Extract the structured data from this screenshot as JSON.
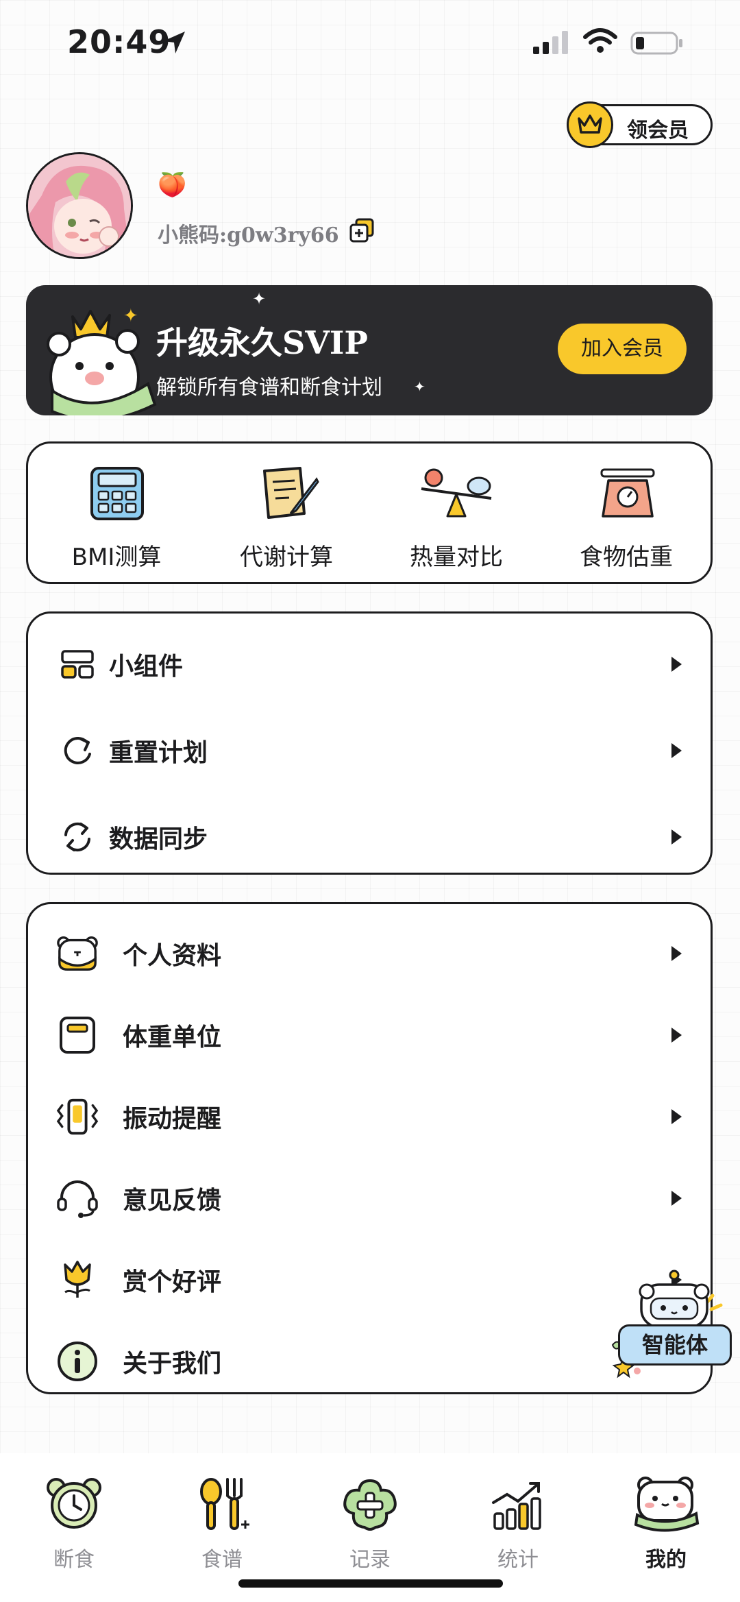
{
  "status_bar": {
    "time": "20:49"
  },
  "vip_button": {
    "label": "领会员"
  },
  "profile": {
    "emoji": "🍑",
    "code_label": "小熊码:g0w3ry66"
  },
  "svip_banner": {
    "title": "升级永久SVIP",
    "subtitle": "解锁所有食谱和断食计划",
    "button_label": "加入会员",
    "colors": {
      "background": "#2b2b2e",
      "button": "#f9c82b"
    }
  },
  "tools": [
    {
      "label": "BMI测算",
      "icon": "calculator-icon"
    },
    {
      "label": "代谢计算",
      "icon": "document-pen-icon"
    },
    {
      "label": "热量对比",
      "icon": "balance-scale-icon"
    },
    {
      "label": "食物估重",
      "icon": "kitchen-scale-icon"
    }
  ],
  "menu_group_1": [
    {
      "label": "小组件",
      "icon": "widget-icon"
    },
    {
      "label": "重置计划",
      "icon": "refresh-icon"
    },
    {
      "label": "数据同步",
      "icon": "sync-icon"
    }
  ],
  "menu_group_2": [
    {
      "label": "个人资料",
      "icon": "bear-profile-icon"
    },
    {
      "label": "体重单位",
      "icon": "scale-icon"
    },
    {
      "label": "振动提醒",
      "icon": "vibration-icon"
    },
    {
      "label": "意见反馈",
      "icon": "headset-icon"
    },
    {
      "label": "赏个好评",
      "icon": "tulip-icon"
    },
    {
      "label": "关于我们",
      "icon": "info-icon"
    }
  ],
  "ai_agent": {
    "label": "智能体"
  },
  "tab_bar": [
    {
      "label": "断食",
      "icon": "alarm-clock-icon",
      "active": false
    },
    {
      "label": "食谱",
      "icon": "utensils-icon",
      "active": false
    },
    {
      "label": "记录",
      "icon": "plus-clover-icon",
      "active": false
    },
    {
      "label": "统计",
      "icon": "chart-icon",
      "active": false
    },
    {
      "label": "我的",
      "icon": "bear-face-icon",
      "active": true
    }
  ],
  "colors": {
    "accent_yellow": "#f9c82b",
    "text": "#1c1c1e",
    "muted": "#8e8e93"
  }
}
